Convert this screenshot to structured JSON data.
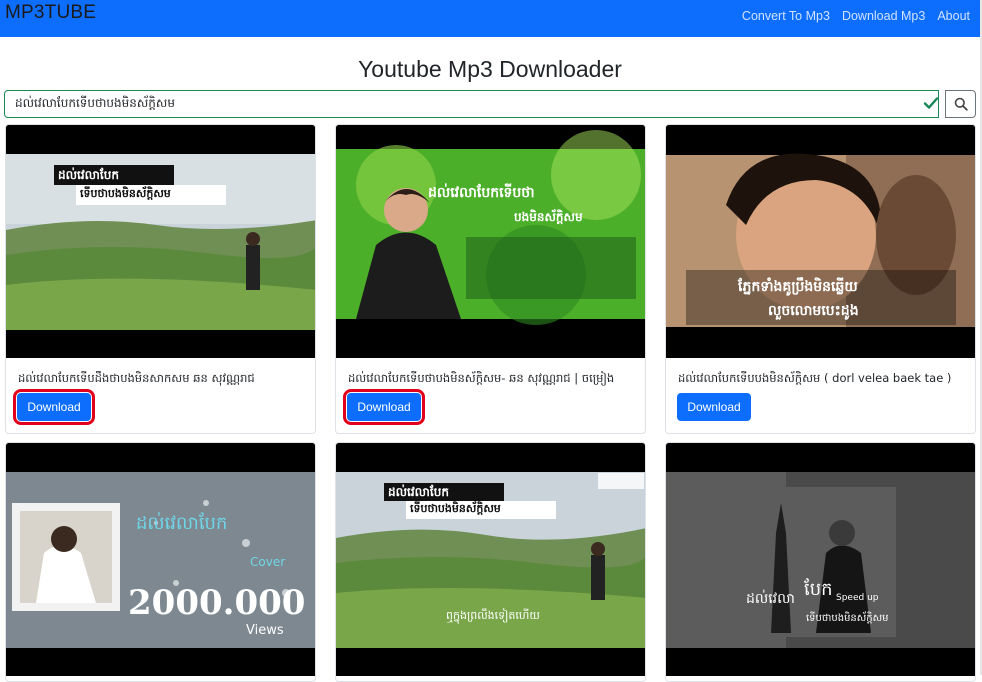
{
  "navbar": {
    "brand": "MP3TUBE",
    "links": [
      "Convert To Mp3",
      "Download Mp3",
      "About"
    ],
    "color": "#0d6efd"
  },
  "page": {
    "title": "Youtube Mp3 Downloader"
  },
  "search": {
    "value": "ដល់វេលាបែកទើបថាបងមិនស័ក្ដិសម",
    "valid_icon": "check-icon",
    "button_icon": "search-icon"
  },
  "cards": [
    {
      "title": "ដល់វេលាបែកទើបដឹងថាបងមិនសាកសម ឆន សុវណ្ណរាជ",
      "button": "Download",
      "highlighted": true,
      "thumb_text": [
        "ដល់វេលាបែក",
        "ទើបថាបងមិនស័ក្ដិសម"
      ]
    },
    {
      "title": "ដល់វេលាបែកទើបថាបងមិនស័ក្ដិសម- ឆន សុវណ្ណរាជ | ចម្រៀង",
      "button": "Download",
      "highlighted": true,
      "thumb_text": [
        "ដល់វេលាបែកទើបថា",
        "បងមិនស័ក្ដិសម"
      ]
    },
    {
      "title": "ដល់វេលាបែកទើបបងមិនស័ក្ដិសម ( dorl velea baek tae )",
      "button": "Download",
      "highlighted": false,
      "thumb_text": [
        "ភ្នែកទាំងគូប្រឹងមិនឆ្លើយ",
        "លួចលោមបេះដូង"
      ]
    },
    {
      "title": "",
      "button": "",
      "highlighted": false,
      "thumb_text": [
        "ដល់វេលាបែក",
        "Cover",
        "2000.000",
        "Views"
      ]
    },
    {
      "title": "",
      "button": "",
      "highlighted": false,
      "thumb_text": [
        "ដល់វេលាបែក",
        "ទើបថាបងមិនស័ក្ដិសម",
        "ឮក្នុងព្រលឹងទៀតហើយ"
      ]
    },
    {
      "title": "",
      "button": "",
      "highlighted": false,
      "thumb_text": [
        "ដល់វេលា",
        "បែក",
        "Speed up",
        "ទើបថាបងមិនស័ក្ដិសម"
      ]
    }
  ]
}
